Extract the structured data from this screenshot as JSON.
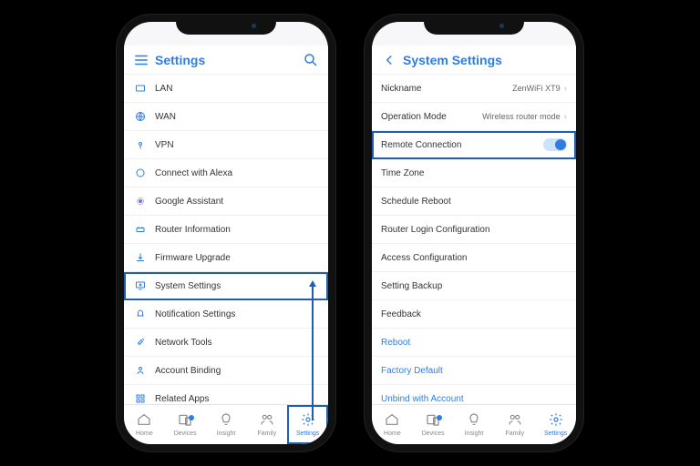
{
  "colors": {
    "accent": "#2f7de1",
    "highlight": "#1f5fb0"
  },
  "phone1": {
    "header": {
      "title": "Settings",
      "leftIcon": "menu-icon",
      "rightIcon": "search-icon"
    },
    "items": [
      {
        "icon": "lan-icon",
        "label": "LAN"
      },
      {
        "icon": "wan-icon",
        "label": "WAN"
      },
      {
        "icon": "vpn-icon",
        "label": "VPN"
      },
      {
        "icon": "alexa-icon",
        "label": "Connect with Alexa"
      },
      {
        "icon": "google-icon",
        "label": "Google Assistant"
      },
      {
        "icon": "router-info-icon",
        "label": "Router Information"
      },
      {
        "icon": "firmware-icon",
        "label": "Firmware Upgrade"
      },
      {
        "icon": "system-settings-icon",
        "label": "System Settings"
      },
      {
        "icon": "notification-icon",
        "label": "Notification Settings"
      },
      {
        "icon": "network-tools-icon",
        "label": "Network Tools"
      },
      {
        "icon": "account-icon",
        "label": "Account Binding"
      },
      {
        "icon": "apps-icon",
        "label": "Related Apps"
      }
    ],
    "highlightedIndex": 7
  },
  "phone2": {
    "header": {
      "title": "System Settings",
      "leftIcon": "back-icon"
    },
    "items": [
      {
        "label": "Nickname",
        "value": "ZenWiFi XT9",
        "chevron": true
      },
      {
        "label": "Operation Mode",
        "value": "Wireless router mode",
        "chevron": true
      },
      {
        "label": "Remote Connection",
        "toggle": true
      },
      {
        "label": "Time Zone"
      },
      {
        "label": "Schedule Reboot"
      },
      {
        "label": "Router Login Configuration"
      },
      {
        "label": "Access Configuration"
      },
      {
        "label": "Setting Backup"
      },
      {
        "label": "Feedback"
      },
      {
        "label": "Reboot",
        "accent": true
      },
      {
        "label": "Factory Default",
        "accent": true
      },
      {
        "label": "Unbind with Account",
        "accent": true
      }
    ],
    "highlightedIndex": 2
  },
  "tabbar": {
    "items": [
      {
        "icon": "home-icon",
        "label": "Home"
      },
      {
        "icon": "devices-icon",
        "label": "Devices",
        "badge": true
      },
      {
        "icon": "insight-icon",
        "label": "Insight"
      },
      {
        "icon": "family-icon",
        "label": "Family"
      },
      {
        "icon": "settings-gear-icon",
        "label": "Settings"
      }
    ],
    "activeIndex": 4
  }
}
